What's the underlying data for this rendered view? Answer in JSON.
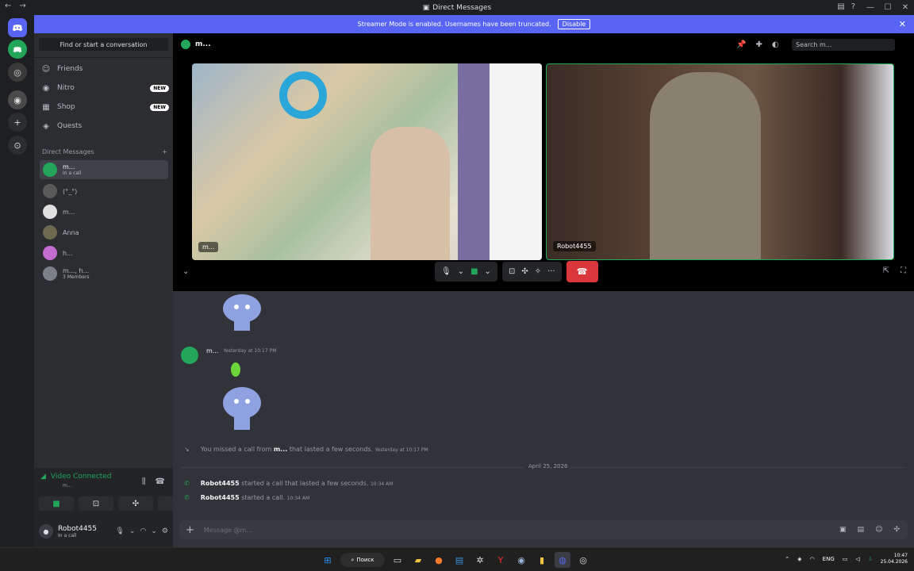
{
  "window": {
    "title": "Direct Messages"
  },
  "banner": {
    "text": "Streamer Mode is enabled. Usernames have been truncated.",
    "disable_label": "Disable"
  },
  "sidebar": {
    "find_placeholder": "Find or start a conversation",
    "nav": [
      {
        "label": "Friends"
      },
      {
        "label": "Nitro",
        "badge": "NEW"
      },
      {
        "label": "Shop",
        "badge": "NEW"
      },
      {
        "label": "Quests"
      }
    ],
    "dm_header": "Direct Messages",
    "dms": [
      {
        "name": "m...",
        "sub": "In a call"
      },
      {
        "name": "(°_°)"
      },
      {
        "name": "m..."
      },
      {
        "name": "Anna"
      },
      {
        "name": "h..."
      },
      {
        "name": "m..., h...",
        "sub": "3 Members"
      }
    ]
  },
  "voice": {
    "status": "Video Connected",
    "channel": "m..."
  },
  "user": {
    "name": "Robot4455",
    "status": "In a call"
  },
  "channel": {
    "name": "m...",
    "search_placeholder": "Search m..."
  },
  "call": {
    "tile1_name": "m...",
    "tile2_name": "Robot4455"
  },
  "messages": {
    "author": "m...",
    "timestamp": "Yesterday at 10:17 PM",
    "missed_prefix": "You missed a call from",
    "missed_from": "m...",
    "missed_suffix": "that lasted a few seconds.",
    "missed_ts": "Yesterday at 10:17 PM",
    "date_sep": "April 25, 2026",
    "sys1_user": "Robot4455",
    "sys1_text": "started a call that lasted a few seconds.",
    "sys1_ts": "10:34 AM",
    "sys2_user": "Robot4455",
    "sys2_text": "started a call.",
    "sys2_ts": "10:34 AM"
  },
  "composer": {
    "placeholder": "Message @m..."
  },
  "taskbar": {
    "search_label": "Поиск",
    "lang": "ENG",
    "time": "10:47",
    "date": "25.04.2026"
  },
  "colors": {
    "blurple": "#5865f2",
    "green": "#23a55a",
    "red": "#da373c"
  }
}
